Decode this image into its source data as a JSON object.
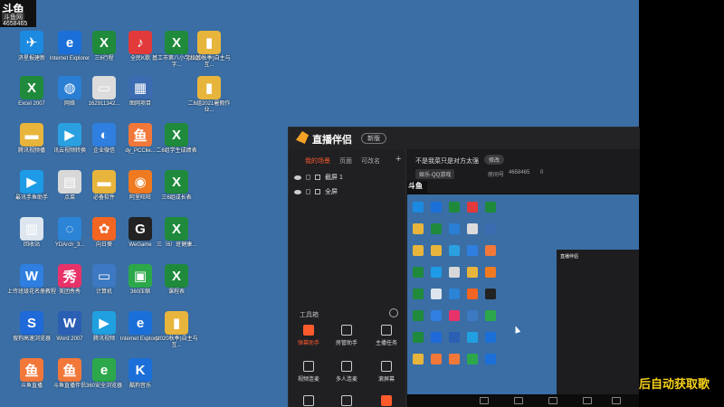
{
  "stream_overlay": {
    "logo": "斗鱼",
    "logo_sub": "斗鱼网",
    "room_id": "4658465",
    "scrolling_text": "后自动获取歌"
  },
  "desktop_icons": [
    {
      "label": "济星报建新",
      "color": "#1c8ae0",
      "glyph": "✈"
    },
    {
      "label": "Internet Explorer",
      "color": "#1b6fd8",
      "glyph": "e"
    },
    {
      "label": "三6行程",
      "color": "#1f8a3b",
      "glyph": "X"
    },
    {
      "label": "全民K歌",
      "color": "#e23a3a",
      "glyph": "♪"
    },
    {
      "label": "基工市第八小学校基字...",
      "color": "#1f8a3b",
      "glyph": "X"
    },
    {
      "label": "(2020秋季)自主与互...",
      "color": "#e8b53c",
      "glyph": "▮"
    },
    {
      "label": "Excel 2007",
      "color": "#1f8a3b",
      "glyph": "X"
    },
    {
      "label": "网络",
      "color": "#2a7fd4",
      "glyph": "◍"
    },
    {
      "label": "162911342...",
      "color": "#dcdcdc",
      "glyph": "▭"
    },
    {
      "label": "图网项目",
      "color": "#3b6bb0",
      "glyph": "▦"
    },
    {
      "label": "二6组2021暑假作业...",
      "color": "#e8b53c",
      "glyph": "▮"
    },
    {
      "label": "腾讯视频播",
      "color": "#e8b53c",
      "glyph": "▬"
    },
    {
      "label": "讯云视频转换",
      "color": "#2aa0e0",
      "glyph": "▶"
    },
    {
      "label": "企业微信",
      "color": "#2f7fe0",
      "glyph": "◐"
    },
    {
      "label": "dy_PCClie...",
      "color": "#f2783a",
      "glyph": "鱼"
    },
    {
      "label": "二6组学生成绩表",
      "color": "#1f8a3b",
      "glyph": "X"
    },
    {
      "label": "最讯手鱼助手",
      "color": "#1d9be6",
      "glyph": "▶"
    },
    {
      "label": "点菜",
      "color": "#d8d8d8",
      "glyph": "▤"
    },
    {
      "label": "必备软件",
      "color": "#e8b53c",
      "glyph": "▬"
    },
    {
      "label": "阿里旺旺",
      "color": "#f07a20",
      "glyph": "◉"
    },
    {
      "label": "三6组成长表",
      "color": "#1f8a3b",
      "glyph": "X"
    },
    {
      "label": "回收站",
      "color": "#dde6ee",
      "glyph": "▥"
    },
    {
      "label": "YDArch_3...",
      "color": "#2b84d6",
      "glyph": "◌"
    },
    {
      "label": "向日葵",
      "color": "#f26522",
      "glyph": "✿"
    },
    {
      "label": "WeGame",
      "color": "#222222",
      "glyph": "G"
    },
    {
      "label": "三（6）班健康...",
      "color": "#1f8a3b",
      "glyph": "X"
    },
    {
      "label": "上传班级花名册教程",
      "color": "#2f7fe0",
      "glyph": "W"
    },
    {
      "label": "美团秀秀",
      "color": "#e8336a",
      "glyph": "秀"
    },
    {
      "label": "计算机",
      "color": "#3d79c2",
      "glyph": "▭"
    },
    {
      "label": "360压缩",
      "color": "#2ca84a",
      "glyph": "▣"
    },
    {
      "label": "课程表",
      "color": "#1f8a3b",
      "glyph": "X"
    },
    {
      "label": "搜狗高速浏览器",
      "color": "#1f6ad8",
      "glyph": "S"
    },
    {
      "label": "Word 2007",
      "color": "#2b5fb4",
      "glyph": "W"
    },
    {
      "label": "腾讯视频",
      "color": "#20a0e0",
      "glyph": "▶"
    },
    {
      "label": "Internet Explorer",
      "color": "#1b6fd8",
      "glyph": "e"
    },
    {
      "label": "(2020秋季)自主与互...",
      "color": "#e8b53c",
      "glyph": "▮"
    },
    {
      "label": "斗鱼直播",
      "color": "#f2783a",
      "glyph": "鱼"
    },
    {
      "label": "斗鱼直播伴侣",
      "color": "#f2783a",
      "glyph": "鱼"
    },
    {
      "label": "360安全浏览器",
      "color": "#2ca84a",
      "glyph": "e"
    },
    {
      "label": "酷狗音乐",
      "color": "#1c6fd8",
      "glyph": "K"
    }
  ],
  "app": {
    "title": "直播伴侣",
    "badge": "新版",
    "tabs": [
      "我的场景",
      "页面",
      "可改名",
      "+"
    ],
    "sources": [
      "截屏 1",
      "全屏"
    ],
    "toolbox_label": "工具箱",
    "tools": [
      {
        "label": "弹幕助手",
        "active": true
      },
      {
        "label": "房管助手",
        "active": false
      },
      {
        "label": "主播任务",
        "active": false
      },
      {
        "label": "视频连麦",
        "active": false
      },
      {
        "label": "多人连麦",
        "active": false
      },
      {
        "label": "滚屏幕",
        "active": false
      },
      {
        "label": "虚拟形象",
        "active": false
      },
      {
        "label": "弹幕库",
        "active": false
      },
      {
        "label": "歌词助手",
        "active": true
      }
    ],
    "stream_title": "不是我菜只是对方太强",
    "edit_label": "修改",
    "category": "娱乐·QQ游戏",
    "room_no_label": "房间号",
    "room_no": "4658465",
    "hot": "0"
  },
  "preview": {
    "logo": "斗鱼",
    "mini_app_title": "直播伴侣"
  }
}
